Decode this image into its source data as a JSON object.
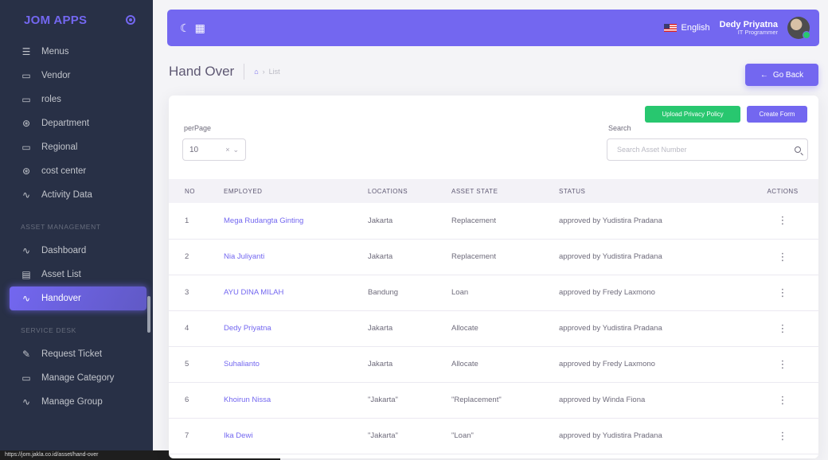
{
  "sidebar": {
    "brand": "JOM APPS",
    "items_top": [
      {
        "label": "Menus",
        "icon": "menu-icon"
      },
      {
        "label": "Vendor",
        "icon": "monitor-icon"
      },
      {
        "label": "roles",
        "icon": "monitor-icon"
      },
      {
        "label": "Department",
        "icon": "aperture-icon"
      },
      {
        "label": "Regional",
        "icon": "monitor-icon"
      },
      {
        "label": "cost center",
        "icon": "aperture-icon"
      },
      {
        "label": "Activity Data",
        "icon": "activity-icon"
      }
    ],
    "section_asset": "ASSET MANAGEMENT",
    "items_asset": [
      {
        "label": "Dashboard",
        "icon": "activity-icon"
      },
      {
        "label": "Asset List",
        "icon": "list-icon"
      },
      {
        "label": "Handover",
        "icon": "activity-icon",
        "active": true
      }
    ],
    "section_service": "SERVICE DESK",
    "items_service": [
      {
        "label": "Request Ticket",
        "icon": "edit-icon"
      },
      {
        "label": "Manage Category",
        "icon": "monitor-icon"
      },
      {
        "label": "Manage Group",
        "icon": "activity-icon"
      }
    ],
    "status_url": "https://jom.jakla.co.id/asset/hand-over"
  },
  "topbar": {
    "language": "English",
    "user_name": "Dedy Priyatna",
    "user_role": "IT Programmer"
  },
  "page": {
    "title": "Hand Over",
    "breadcrumb_current": "List",
    "go_back_label": "Go Back"
  },
  "card": {
    "upload_label": "Upload Privacy Policy",
    "create_label": "Create Form",
    "perpage_label": "perPage",
    "perpage_value": "10",
    "search_label": "Search",
    "search_placeholder": "Search Asset Number"
  },
  "table": {
    "headers": [
      "NO",
      "EMPLOYED",
      "LOCATIONS",
      "ASSET STATE",
      "STATUS",
      "ACTIONS"
    ],
    "rows": [
      {
        "no": "1",
        "employed": "Mega Rudangta Ginting",
        "location": "Jakarta",
        "asset_state": "Replacement",
        "status": "approved by Yudistira Pradana"
      },
      {
        "no": "2",
        "employed": "Nia Juliyanti",
        "location": "Jakarta",
        "asset_state": "Replacement",
        "status": "approved by Yudistira Pradana"
      },
      {
        "no": "3",
        "employed": "AYU DINA MILAH",
        "location": "Bandung",
        "asset_state": "Loan",
        "status": "approved by Fredy Laxmono"
      },
      {
        "no": "4",
        "employed": "Dedy Priyatna",
        "location": "Jakarta",
        "asset_state": "Allocate",
        "status": "approved by Yudistira Pradana"
      },
      {
        "no": "5",
        "employed": "Suhalianto",
        "location": "Jakarta",
        "asset_state": "Allocate",
        "status": "approved by Fredy Laxmono"
      },
      {
        "no": "6",
        "employed": "Khoirun Nissa",
        "location": "\"Jakarta\"",
        "asset_state": "\"Replacement\"",
        "status": "approved by Winda Fiona"
      },
      {
        "no": "7",
        "employed": "Ika Dewi",
        "location": "\"Jakarta\"",
        "asset_state": "\"Loan\"",
        "status": "approved by Yudistira Pradana"
      }
    ]
  },
  "colors": {
    "primary": "#7367f0",
    "success": "#28c76f",
    "sidebar_bg": "#283046"
  }
}
